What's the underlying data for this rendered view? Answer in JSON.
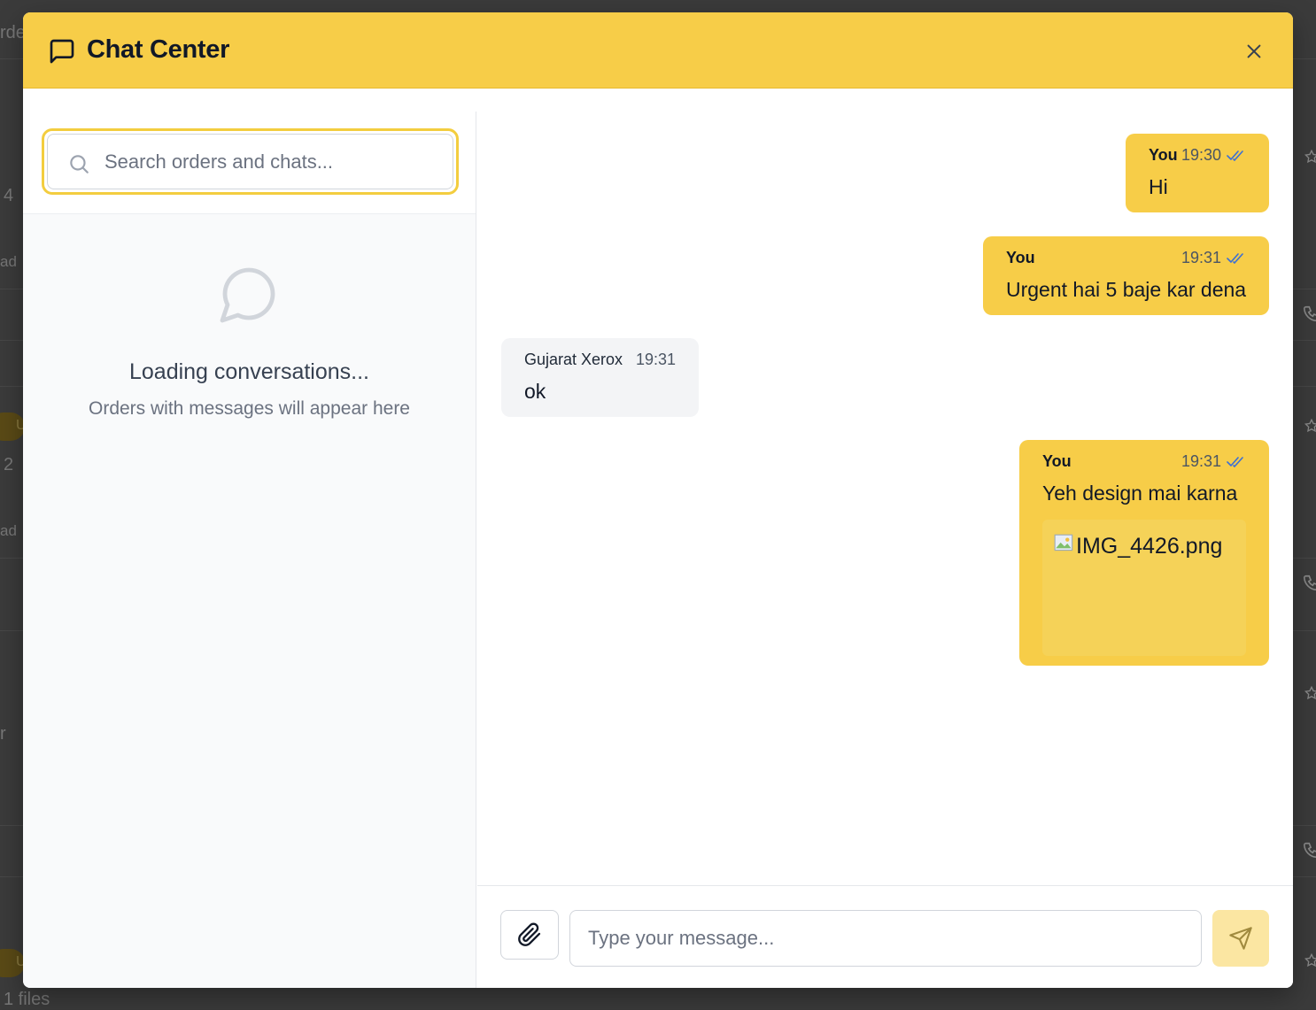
{
  "background": {
    "texts": [
      "rde",
      "4",
      "ad",
      "U",
      "2",
      "ad",
      "r",
      "U",
      "1 files"
    ]
  },
  "header": {
    "title": "Chat Center",
    "icon": "message-square-icon",
    "close_icon": "close-icon"
  },
  "sidebar": {
    "search_placeholder": "Search orders and chats...",
    "empty_title": "Loading conversations...",
    "empty_subtitle": "Orders with messages will appear here"
  },
  "messages": [
    {
      "sender": "You",
      "time": "19:30",
      "text": "Hi",
      "from_me": true,
      "read": true
    },
    {
      "sender": "You",
      "time": "19:31",
      "text": "Urgent hai 5 baje kar dena",
      "from_me": true,
      "read": true
    },
    {
      "sender": "Gujarat Xerox",
      "time": "19:31",
      "text": "ok",
      "from_me": false
    },
    {
      "sender": "You",
      "time": "19:31",
      "text": "Yeh design mai karna",
      "from_me": true,
      "read": true,
      "attachment": "IMG_4426.png"
    }
  ],
  "composer": {
    "placeholder": "Type your message...",
    "attach_icon": "paperclip-icon",
    "send_icon": "send-icon"
  },
  "colors": {
    "accent": "#f7cd48",
    "bubble_other": "#f3f4f6",
    "send_disabled": "#fbe6a2",
    "check_blue": "#3b6fd6"
  }
}
